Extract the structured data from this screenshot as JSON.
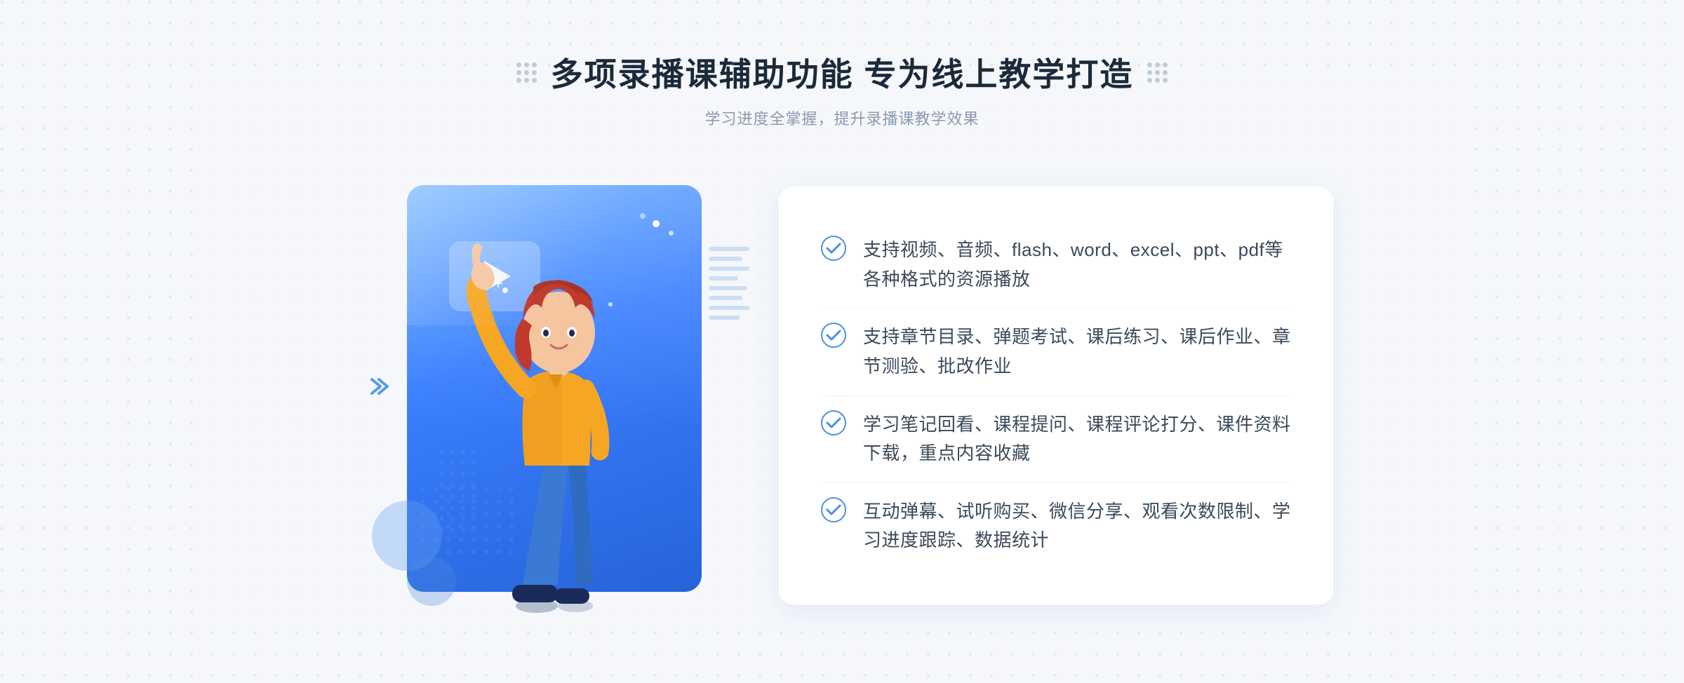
{
  "header": {
    "main_title": "多项录播课辅助功能 专为线上教学打造",
    "subtitle": "学习进度全掌握，提升录播课教学效果"
  },
  "features": [
    {
      "id": 1,
      "text": "支持视频、音频、flash、word、excel、ppt、pdf等各种格式的资源播放"
    },
    {
      "id": 2,
      "text": "支持章节目录、弹题考试、课后练习、课后作业、章节测验、批改作业"
    },
    {
      "id": 3,
      "text": "学习笔记回看、课程提问、课程评论打分、课件资料下载，重点内容收藏"
    },
    {
      "id": 4,
      "text": "互动弹幕、试听购买、微信分享、观看次数限制、学习进度跟踪、数据统计"
    }
  ],
  "colors": {
    "primary_blue": "#4a8cee",
    "dark_blue": "#2563d9",
    "light_blue": "#a0c4f4",
    "text_dark": "#1a2a3a",
    "text_mid": "#3a4a5a",
    "text_light": "#8a9ab0",
    "bg": "#f5f7fa"
  }
}
